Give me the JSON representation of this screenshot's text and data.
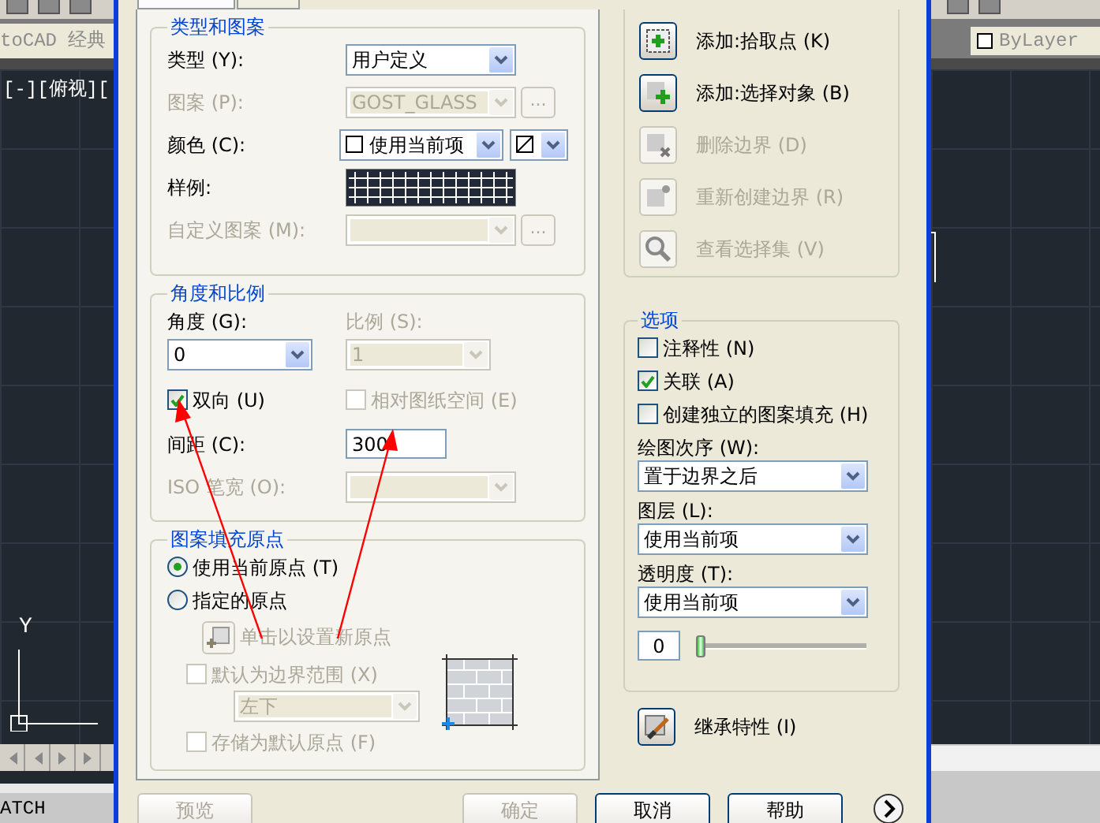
{
  "cad_left": {
    "workspace": "toCAD 经典",
    "viewport_label": "[-][俯视][",
    "ucs_axis": "Y",
    "command_line": "ATCH"
  },
  "cad_right": {
    "layer_field": "ByLayer"
  },
  "dialog": {
    "tabs": [
      {
        "selected": true
      },
      {
        "selected": false
      }
    ],
    "type_pattern": {
      "title": "类型和图案",
      "rows": [
        {
          "kind": "select",
          "label": "类型 (Y):",
          "value": "用户定义",
          "disabled": false
        },
        {
          "kind": "browse",
          "label": "图案 (P):",
          "value": "GOST_GLASS",
          "button": "...",
          "disabled": true
        },
        {
          "kind": "color",
          "label": "颜色 (C):",
          "value": "使用当前项",
          "disabled": false
        },
        {
          "kind": "swatch",
          "label": "样例:",
          "disabled": false
        },
        {
          "kind": "browse",
          "label": "自定义图案 (M):",
          "button": "...",
          "disabled": true
        }
      ]
    },
    "angle_scale": {
      "title": "角度和比例",
      "selects": [
        {
          "label": "角度 (G):",
          "value": "0",
          "disabled": false
        },
        {
          "label": "比例 (S):",
          "value": "1",
          "disabled": true
        }
      ],
      "checks": [
        {
          "label": "双向 (U)",
          "checked": true,
          "disabled": false
        },
        {
          "label": "相对图纸空间 (E)",
          "checked": false,
          "disabled": true
        }
      ],
      "spacing": {
        "label": "间距 (C):",
        "value": "300",
        "disabled": false
      },
      "iso": {
        "label": "ISO 笔宽 (O):",
        "disabled": true
      }
    },
    "origin": {
      "title": "图案填充原点",
      "radios": [
        {
          "label": "使用当前原点 (T)",
          "selected": true
        },
        {
          "label": "指定的原点",
          "selected": false
        }
      ],
      "set_origin": {
        "label": "单击以设置新原点",
        "disabled": true
      },
      "default_extents": {
        "label": "默认为边界范围 (X)",
        "checked": false,
        "disabled": true
      },
      "position": {
        "value": "左下",
        "disabled": true
      },
      "store_default": {
        "label": "存储为默认原点 (F)",
        "checked": false,
        "disabled": true
      }
    },
    "boundaries": [
      {
        "kind": "pick",
        "label": "添加:拾取点 (K)",
        "disabled": false
      },
      {
        "kind": "select",
        "label": "添加:选择对象 (B)",
        "disabled": false
      },
      {
        "kind": "remove",
        "label": "删除边界 (D)",
        "disabled": true
      },
      {
        "kind": "recreate",
        "label": "重新创建边界 (R)",
        "disabled": true
      },
      {
        "kind": "view",
        "label": "查看选择集 (V)",
        "disabled": true
      }
    ],
    "options": {
      "title": "选项",
      "checks": [
        {
          "label": "注释性 (N)",
          "checked": false
        },
        {
          "label": "关联 (A)",
          "checked": true
        },
        {
          "label": "创建独立的图案填充 (H)",
          "checked": false
        }
      ],
      "selects": [
        {
          "label": "绘图次序 (W):",
          "value": "置于边界之后"
        },
        {
          "label": "图层 (L):",
          "value": "使用当前项"
        },
        {
          "label": "透明度 (T):",
          "value": "使用当前项"
        }
      ],
      "transparency": {
        "value": "0",
        "level": 0
      }
    },
    "inherit": {
      "label": "继承特性 (I)"
    },
    "footer": [
      {
        "label": "预览",
        "disabled": true
      },
      {
        "label": "确定",
        "disabled": true
      },
      {
        "label": "取消",
        "disabled": false
      },
      {
        "label": "帮助",
        "disabled": false
      }
    ]
  }
}
